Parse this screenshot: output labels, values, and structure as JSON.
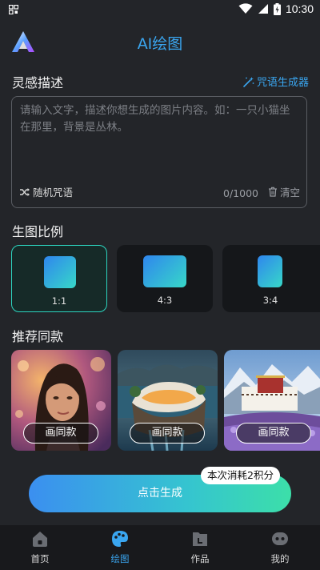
{
  "status_bar": {
    "time": "10:30"
  },
  "header": {
    "title": "AI绘图"
  },
  "inspiration": {
    "title": "灵感描述",
    "spell_generator_label": "咒语生成器",
    "placeholder": "请输入文字，描述你想生成的图片内容。如：一只小猫坐在那里，背景是丛林。",
    "value": "",
    "random_spell_label": "随机咒语",
    "counter": "0/1000",
    "clear_label": "清空"
  },
  "ratio": {
    "title": "生图比例",
    "options": [
      {
        "label": "1:1",
        "selected": true
      },
      {
        "label": "4:3",
        "selected": false
      },
      {
        "label": "3:4",
        "selected": false
      }
    ]
  },
  "recommend": {
    "title": "推荐同款",
    "items": [
      {
        "button_label": "画同款"
      },
      {
        "button_label": "画同款"
      },
      {
        "button_label": "画同款"
      }
    ]
  },
  "generate": {
    "button_label": "点击生成",
    "cost_badge": "本次消耗2积分"
  },
  "tabbar": {
    "tabs": [
      {
        "label": "首页",
        "icon": "home-icon",
        "active": false
      },
      {
        "label": "绘图",
        "icon": "palette-icon",
        "active": true
      },
      {
        "label": "作品",
        "icon": "folder-icon",
        "active": false
      },
      {
        "label": "我的",
        "icon": "profile-icon",
        "active": false
      }
    ]
  },
  "colors": {
    "accent": "#3aa6f0",
    "teal": "#2dd4bf",
    "background": "#232529"
  }
}
